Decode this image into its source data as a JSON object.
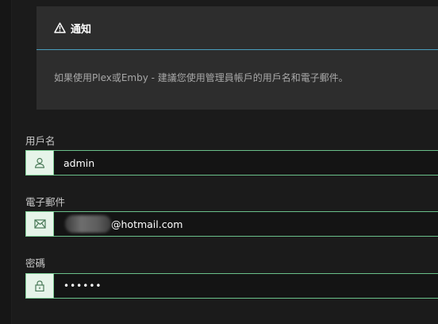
{
  "notice": {
    "title": "通知",
    "message": "如果使用Plex或Emby - 建議您使用管理員帳戶的用戶名和電子郵件。",
    "icon": "warning-icon",
    "accent_color": "#4a9ebd"
  },
  "form": {
    "username": {
      "label": "用戶名",
      "value": "admin",
      "icon": "user-icon"
    },
    "email": {
      "label": "電子郵件",
      "value_suffix": "@hotmail.com",
      "icon": "mail-icon"
    },
    "password": {
      "label": "密碼",
      "value": "••••••",
      "icon": "lock-icon"
    },
    "field_accent_color": "#6ac08a"
  }
}
